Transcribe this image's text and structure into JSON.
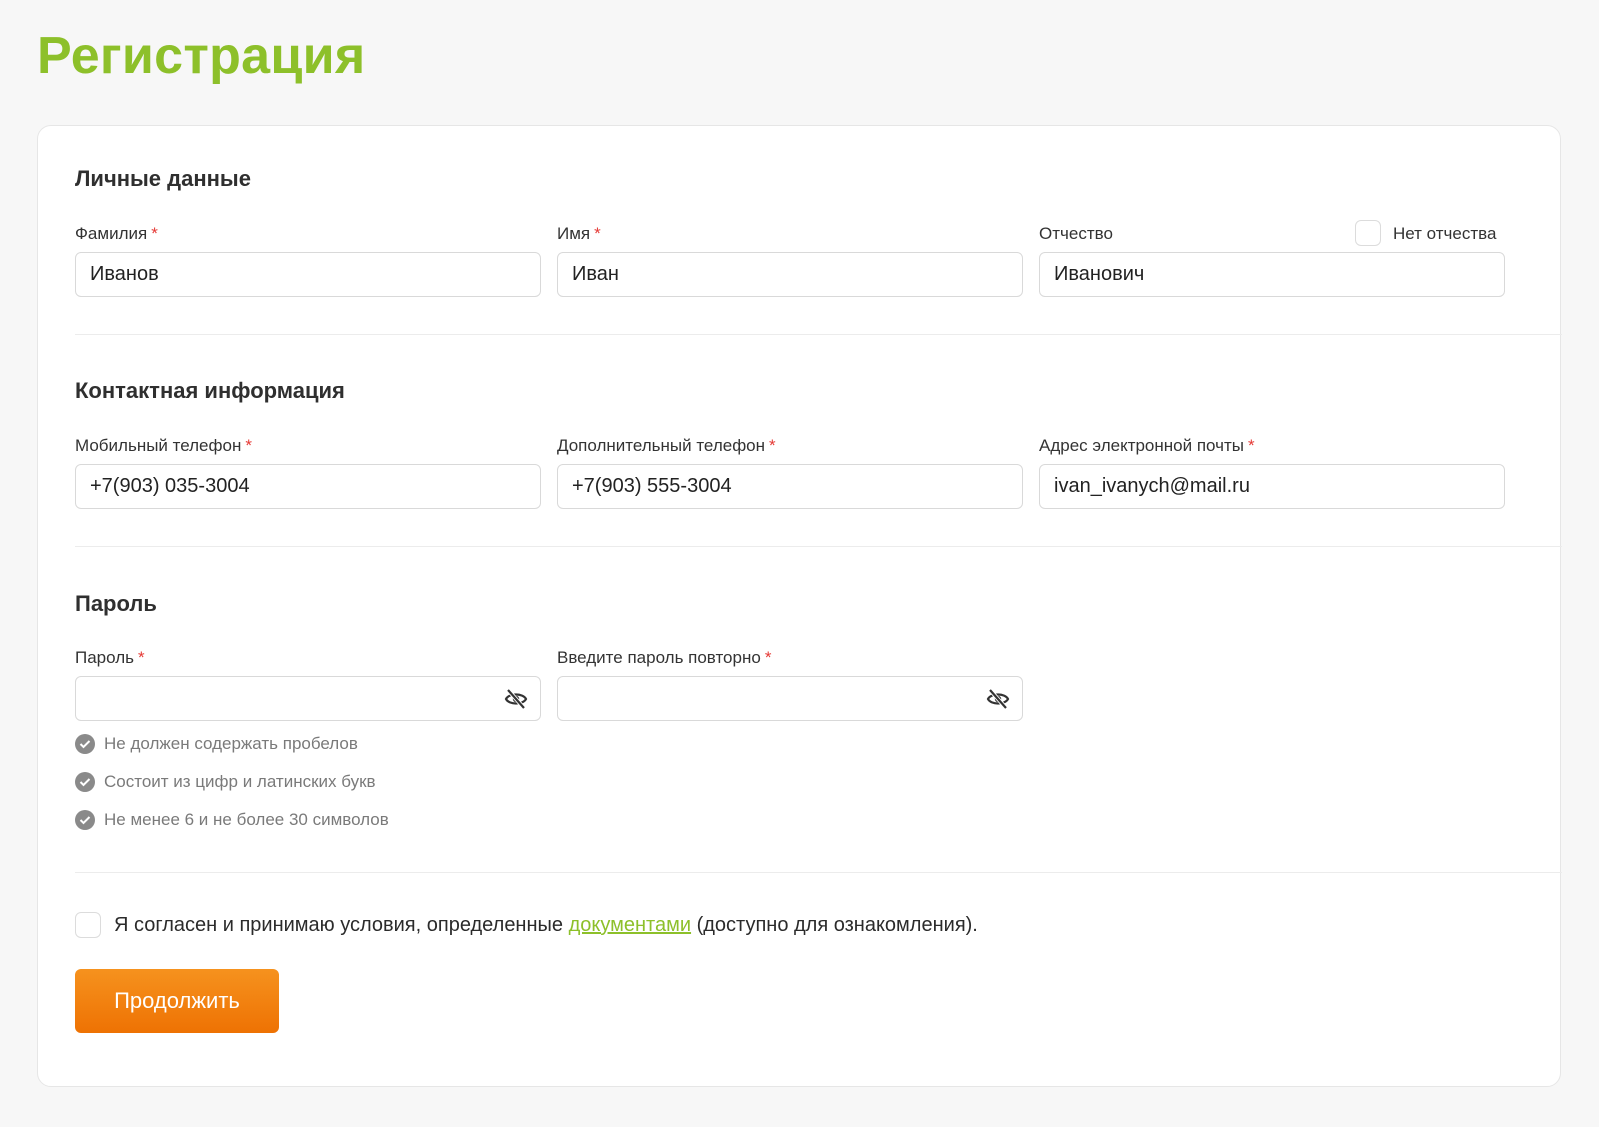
{
  "title": "Регистрация",
  "personal": {
    "heading": "Личные данные",
    "surname": {
      "label": "Фамилия",
      "value": "Иванов"
    },
    "name": {
      "label": "Имя",
      "value": "Иван"
    },
    "patronymic": {
      "label": "Отчество",
      "value": "Иванович"
    },
    "no_patronymic_label": "Нет отчества",
    "required_mark": "*"
  },
  "contact": {
    "heading": "Контактная информация",
    "mobile": {
      "label": "Мобильный телефон",
      "value": "+7(903) 035-3004"
    },
    "extra_phone": {
      "label": "Дополнительный телефон",
      "value": "+7(903) 555-3004"
    },
    "email": {
      "label": "Адрес электронной почты",
      "value": "ivan_ivanych@mail.ru"
    }
  },
  "password": {
    "heading": "Пароль",
    "password_label": "Пароль",
    "repeat_label": "Введите пароль повторно",
    "rules": [
      "Не должен содержать пробелов",
      "Состоит из цифр и латинских букв",
      "Не менее 6 и не более 30 символов"
    ]
  },
  "agreement": {
    "text_before": "Я согласен и принимаю условия, определенные ",
    "link_text": "документами",
    "text_after": " (доступно для ознакомления)."
  },
  "continue_label": "Продолжить",
  "colors": {
    "accent_green": "#8dc02a",
    "button_orange": "#f08000",
    "required_red": "#e53935"
  },
  "icons": {
    "password_toggle": "eye-slash-icon",
    "rule_check": "check-circle-icon"
  }
}
